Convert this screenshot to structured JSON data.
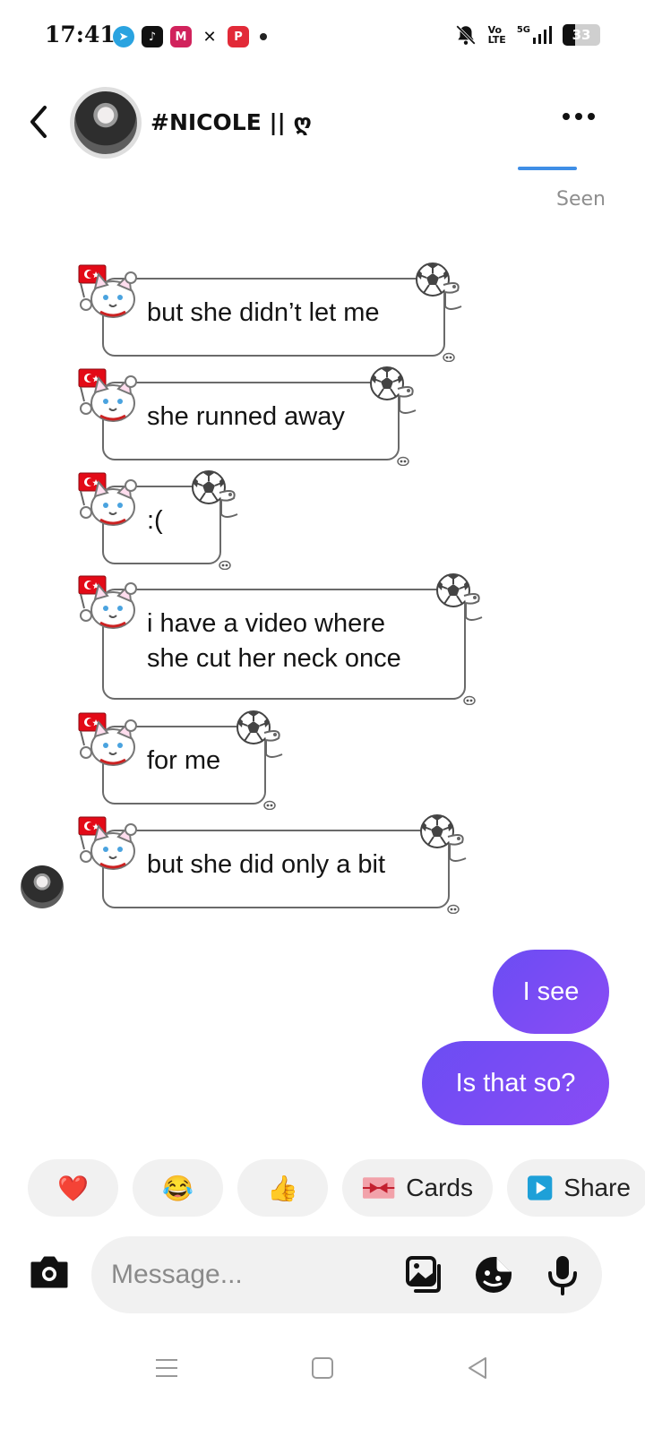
{
  "status_bar": {
    "time": "17:41",
    "app_icons": [
      "telegram-icon",
      "tiktok-icon",
      "mi-app-icon",
      "capcut-icon",
      "pinterest-icon"
    ],
    "volte": "Vo\nLTE",
    "network": "5G",
    "battery": "33"
  },
  "header": {
    "contact_name": "#NICOLE || ღ",
    "back_icon": "chevron-left-icon",
    "more_icon": "more-horizontal-icon"
  },
  "conversation": {
    "seen": "Seen",
    "received": [
      {
        "text": "but she didn’t let me"
      },
      {
        "text": "she runned away"
      },
      {
        "text": ":("
      },
      {
        "text": "i have a video where\nshe cut her neck once"
      },
      {
        "text": "for me"
      },
      {
        "text": "but she did only a bit"
      }
    ],
    "sent": [
      {
        "text": "I see"
      },
      {
        "text": "Is that so?"
      }
    ]
  },
  "quick_actions": {
    "reactions": [
      "❤️",
      "😂",
      "👍"
    ],
    "cards_label": "Cards",
    "share_label": "Share"
  },
  "composer": {
    "placeholder": "Message..."
  },
  "colors": {
    "sent_bubble": "#6b4df3",
    "sticker_outline": "#6a6a6a",
    "chip_bg": "#f1f1f1"
  }
}
